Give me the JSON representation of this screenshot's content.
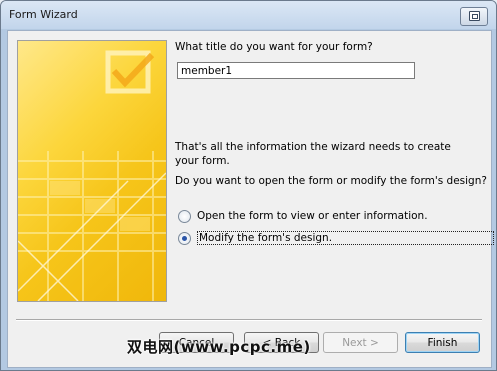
{
  "window": {
    "title": "Form Wizard"
  },
  "form": {
    "title_question": "What title do you want for your form?",
    "title_value": "member1",
    "info_text": "That's all the information the wizard needs to create your form.",
    "open_question": "Do you want to open the form or modify the form's design?",
    "options": [
      {
        "label": "Open the form to view or enter information.",
        "selected": false
      },
      {
        "label": "Modify the form's design.",
        "selected": true
      }
    ]
  },
  "buttons": {
    "cancel": "Cancel",
    "back": "< Back",
    "next": "Next >",
    "finish": "Finish"
  },
  "watermark": "双电网(www.pcpc.me)",
  "colors": {
    "graphic_yellow": "#f6c51a",
    "accent_blue": "#2a55a8"
  }
}
